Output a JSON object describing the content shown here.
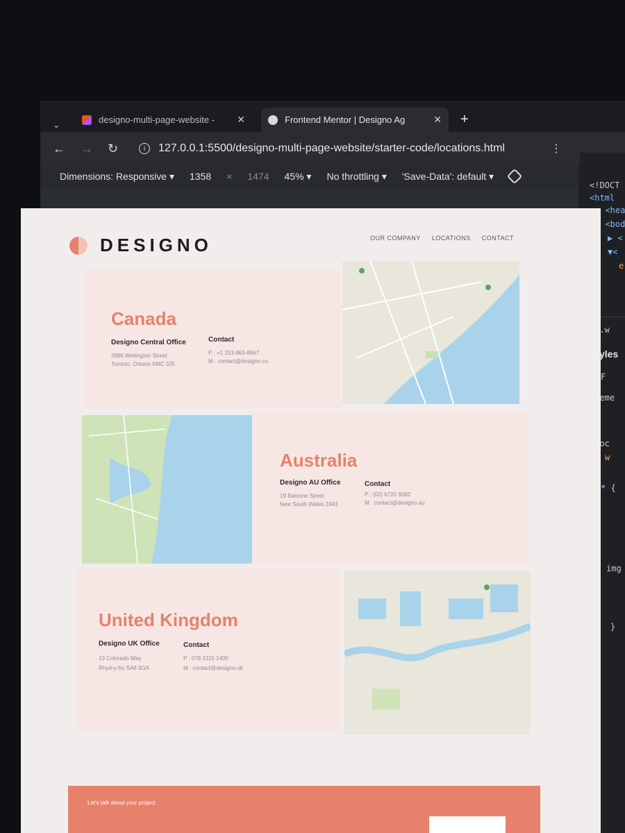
{
  "browser": {
    "tabs": [
      {
        "title": "designo-multi-page-website -",
        "active": false
      },
      {
        "title": "Frontend Mentor | Designo Ag",
        "active": true
      }
    ],
    "url": "127.0.0.1:5500/designo-multi-page-website/starter-code/locations.html"
  },
  "devtools_toolbar": {
    "dimensions": "Dimensions: Responsive",
    "width": "1358",
    "times": "×",
    "height": "1474",
    "zoom": "45%",
    "throttling": "No throttling",
    "save_data": "'Save-Data': default"
  },
  "devtools_panel": {
    "lines": [
      "<!DOCT",
      "<html",
      "▶ <hea",
      "▼ <bod",
      "▶ <",
      "▼<",
      "e"
    ],
    "crumb": "id.w",
    "styles_label": "Styles",
    "filter": "F",
    "element": "eleme",
    "brace_close": "}",
    "selector_loc": ".loc",
    "prop_w": "w",
    "star": "* {",
    "img": "img"
  },
  "page": {
    "logo": "DESIGNO",
    "nav": [
      "OUR COMPANY",
      "LOCATIONS",
      "CONTACT"
    ],
    "locations": [
      {
        "country": "Canada",
        "office": "Designo Central Office",
        "address": [
          "3886 Wellington Street",
          "Toronto, Ontario M9C 3J5"
        ],
        "contact_title": "Contact",
        "phone": "P : +1 253-863-8967",
        "mail": "M : contact@designo.co"
      },
      {
        "country": "Australia",
        "office": "Designo AU Office",
        "address": [
          "19 Balonne Street",
          "New South Wales 2443"
        ],
        "contact_title": "Contact",
        "phone": "P : (02) 6720 9092",
        "mail": "M : contact@designo.au"
      },
      {
        "country": "United Kingdom",
        "office": "Designo UK Office",
        "address": [
          "13 Colorado Way",
          "Rhyd-y-fro SA8 9GA"
        ],
        "contact_title": "Contact",
        "phone": "P : 078 3115 1400",
        "mail": "M : contact@designo.uk"
      }
    ],
    "cta_text": "Let's talk about your project"
  },
  "colors": {
    "peach": "#e7816b",
    "card": "#f7e7e4",
    "water": "#a9d3ea",
    "land": "#e9e6dc"
  }
}
